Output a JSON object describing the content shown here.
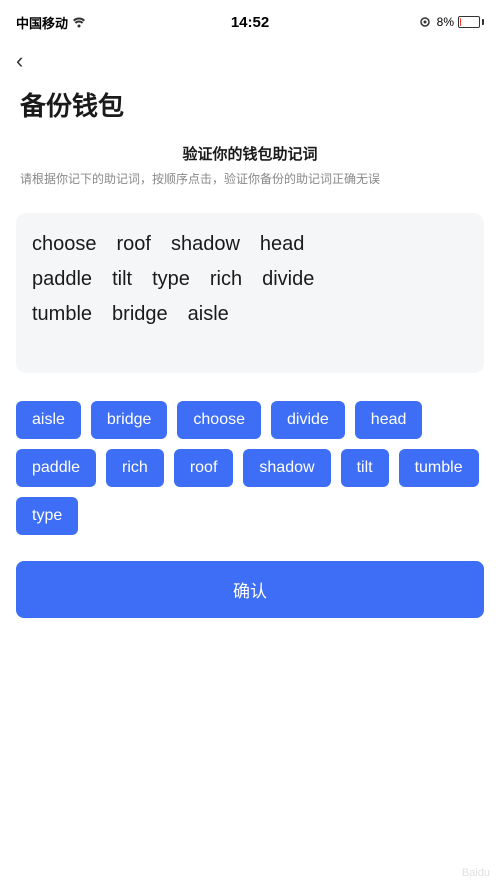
{
  "statusBar": {
    "carrier": "中国移动",
    "time": "14:52",
    "battery": "8%"
  },
  "backButton": "‹",
  "pageTitle": "备份钱包",
  "instruction": {
    "title": "验证你的钱包助记词",
    "desc": "请根据你记下的助记词，按顺序点击，验证你备份的助记词正确无误"
  },
  "displayWords": {
    "row1": [
      "choose",
      "roof",
      "shadow",
      "head"
    ],
    "row2": [
      "paddle",
      "tilt",
      "type",
      "rich",
      "divide"
    ],
    "row3": [
      "tumble",
      "bridge",
      "aisle"
    ]
  },
  "chips": [
    "aisle",
    "bridge",
    "choose",
    "divide",
    "head",
    "paddle",
    "rich",
    "roof",
    "shadow",
    "tilt",
    "tumble",
    "type"
  ],
  "confirmButton": "确认"
}
